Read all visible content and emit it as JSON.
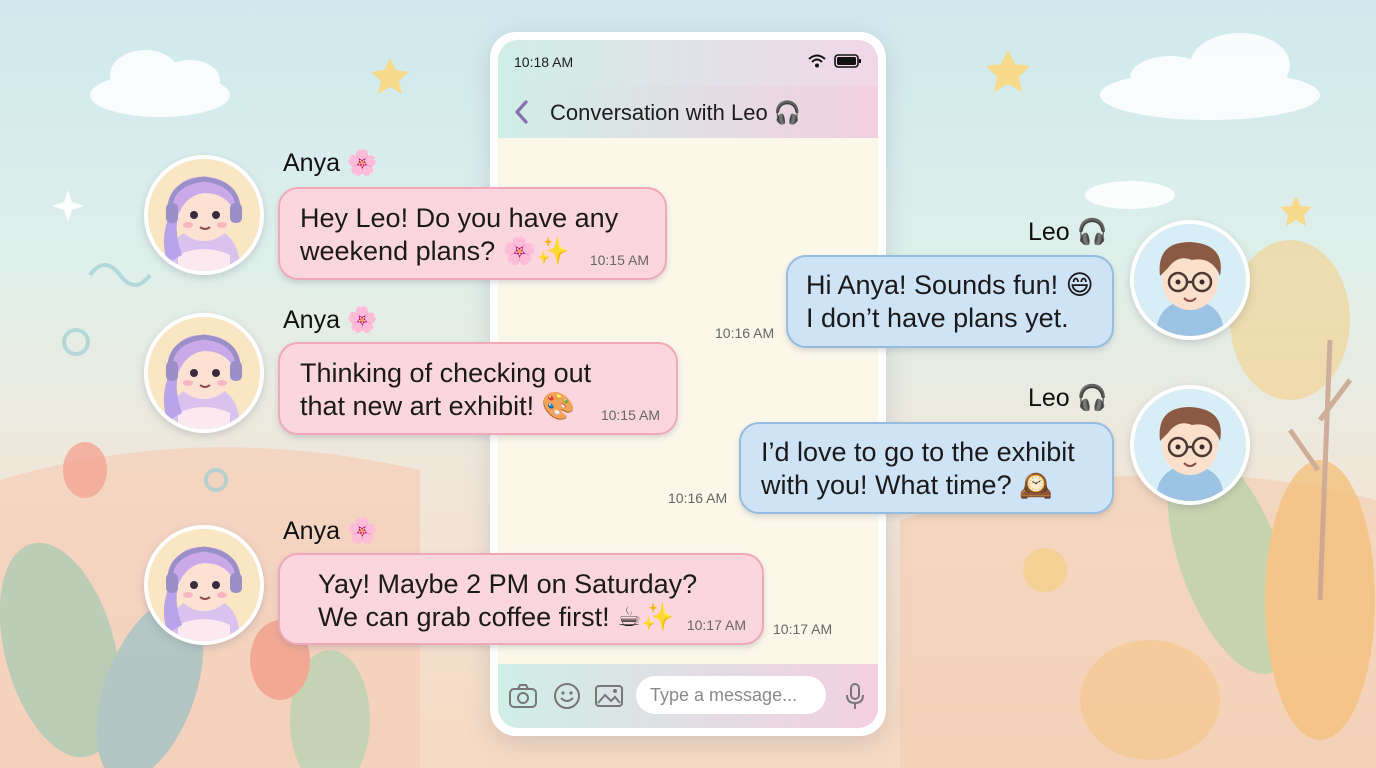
{
  "status_bar": {
    "time": "10:18 AM"
  },
  "header": {
    "title": "Conversation with Leo 🎧"
  },
  "composer": {
    "placeholder": "Type a message...",
    "icons": [
      "camera-icon",
      "smiley-icon",
      "image-icon",
      "microphone-icon"
    ]
  },
  "messages": [
    {
      "sender": "Anya 🌸",
      "text": "Hey Leo! Do you have any\nweekend plans? 🌸✨",
      "time": "10:15 AM"
    },
    {
      "sender": "Leo 🎧",
      "text": "Hi Anya! Sounds fun! 😄\nI don’t have plans yet.",
      "time": "10:16 AM"
    },
    {
      "sender": "Anya 🌸",
      "text": "Thinking of checking out\nthat new art exhibit! 🎨",
      "time": "10:15 AM"
    },
    {
      "sender": "Leo 🎧",
      "text": "I’d love to go to the exhibit\nwith you! What time? 🕰️",
      "time": "10:16 AM"
    },
    {
      "sender": "Anya 🌸",
      "text": "Yay! Maybe 2 PM on Saturday?\nWe can grab coffee first! ☕✨",
      "time": "10:17 AM"
    }
  ],
  "extra_timestamp": "10:17 AM",
  "colors": {
    "anya_bubble": "#fbd6de",
    "leo_bubble": "#cfe3f6",
    "chat_background": "#fbf8ea"
  }
}
